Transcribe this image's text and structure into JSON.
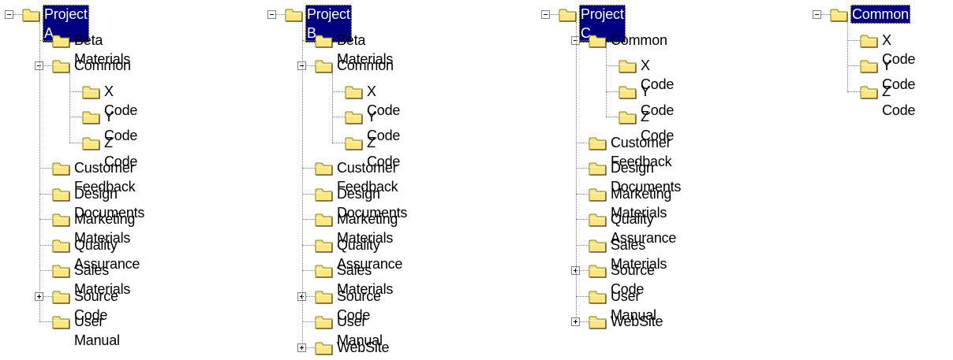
{
  "trees": [
    {
      "label": "Project A",
      "selected": true,
      "expanded": true,
      "children": [
        {
          "label": "Beta Materials"
        },
        {
          "label": "Common",
          "expander": "minus",
          "children": [
            {
              "label": "X Code"
            },
            {
              "label": "Y Code"
            },
            {
              "label": "Z Code"
            }
          ]
        },
        {
          "label": "Customer Feedback"
        },
        {
          "label": "Design Documents"
        },
        {
          "label": "Marketing Materials"
        },
        {
          "label": "Quality Assurance"
        },
        {
          "label": "Sales Materials"
        },
        {
          "label": "Source Code",
          "expander": "plus"
        },
        {
          "label": "User Manual"
        }
      ]
    },
    {
      "label": "Project B",
      "selected": true,
      "expanded": true,
      "children": [
        {
          "label": "Beta Materials"
        },
        {
          "label": "Common",
          "expander": "minus",
          "children": [
            {
              "label": "X Code"
            },
            {
              "label": "Y Code"
            },
            {
              "label": "Z Code"
            }
          ]
        },
        {
          "label": "Customer Feedback"
        },
        {
          "label": "Design Documents"
        },
        {
          "label": "Marketing Materials"
        },
        {
          "label": "Quality Assurance"
        },
        {
          "label": "Sales Materials"
        },
        {
          "label": "Source Code",
          "expander": "plus"
        },
        {
          "label": "User Manual"
        },
        {
          "label": "WebSite",
          "expander": "plus"
        }
      ]
    },
    {
      "label": "Project C",
      "selected": true,
      "expanded": true,
      "children": [
        {
          "label": "Common",
          "expander": "minus",
          "children": [
            {
              "label": "X Code"
            },
            {
              "label": "Y Code"
            },
            {
              "label": "Z Code"
            }
          ]
        },
        {
          "label": "Customer Feedback"
        },
        {
          "label": "Design Documents"
        },
        {
          "label": "Marketing Materials"
        },
        {
          "label": "Quality Assurance"
        },
        {
          "label": "Sales Materials"
        },
        {
          "label": "Source Code",
          "expander": "plus"
        },
        {
          "label": "User Manual"
        },
        {
          "label": "WebSite",
          "expander": "plus"
        }
      ]
    },
    {
      "label": "Common",
      "selected": true,
      "expanded": true,
      "children": [
        {
          "label": "X Code"
        },
        {
          "label": "Y Code"
        },
        {
          "label": "Z Code"
        }
      ]
    }
  ],
  "colors": {
    "selection_bg": "#000080",
    "selection_text": "#ffffff",
    "folder_face": "#ffe680",
    "folder_edge": "#808000",
    "connector": "#808080"
  },
  "icons": {
    "folder": "folder-icon",
    "expand": "plus-box-icon",
    "collapse": "minus-box-icon"
  }
}
